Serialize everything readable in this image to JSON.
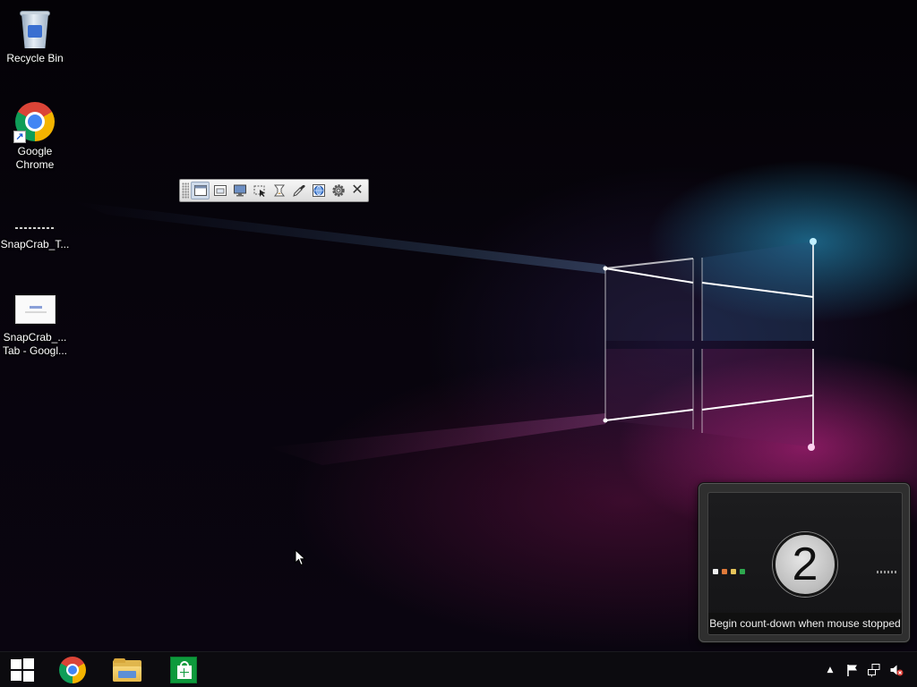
{
  "desktop": {
    "icons": [
      {
        "label": "Recycle Bin",
        "icon": "recycle-bin-icon"
      },
      {
        "label": "Google\nChrome",
        "icon": "chrome-icon"
      },
      {
        "label": "SnapCrab_T...",
        "icon": "image-file-icon"
      },
      {
        "label": "SnapCrab_...\nTab - Googl...",
        "icon": "image-file-icon"
      }
    ]
  },
  "snapcrab_toolbar": {
    "buttons": [
      "window-capture-icon",
      "window-client-capture-icon",
      "fullscreen-capture-icon",
      "region-capture-icon",
      "timer-icon",
      "eyedropper-icon",
      "web-page-capture-icon",
      "settings-icon",
      "close-icon"
    ],
    "close_glyph": "✕"
  },
  "countdown": {
    "number": "2",
    "caption": "Begin count-down when mouse stopped"
  },
  "taskbar": {
    "items": [
      "start-icon",
      "chrome-icon",
      "file-explorer-icon",
      "store-icon"
    ],
    "tray": [
      "show-hidden-icons-icon",
      "action-center-flag-icon",
      "network-icon",
      "volume-muted-icon"
    ],
    "tray_chevron": "▲"
  },
  "colors": {
    "taskbar": "#0c0b0f",
    "toolbar": "#e6e6e6",
    "countdown_bg": "#2f2f2f",
    "wallpaper_blue": "#28aadc",
    "wallpaper_pink": "#dc2896"
  }
}
